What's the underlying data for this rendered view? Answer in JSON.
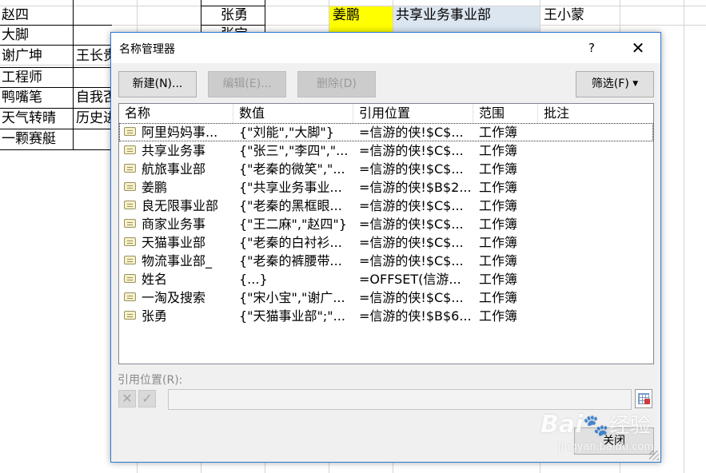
{
  "sheet": {
    "colA": [
      "赵四",
      "大脚",
      "谢广坤",
      "工程师",
      "鸭嘴笔",
      "天气转晴",
      "一颗赛艇"
    ],
    "colB": [
      "王长贵",
      "自我否",
      "历史进"
    ],
    "colD": [
      "张勇",
      "张宝"
    ],
    "header_row": {
      "highlight_cell": "姜鹏",
      "dept_cell": "共享业务事业部",
      "person_cell": "王小蒙"
    },
    "colors": {
      "yellow": "#ffff00",
      "light_blue": "#dce6f1"
    }
  },
  "dialog": {
    "title": "名称管理器",
    "help": "?",
    "buttons": {
      "new": "新建(N)...",
      "edit": "编辑(E)...",
      "delete": "删除(D)",
      "filter": "筛选(F)",
      "close": "关闭"
    },
    "columns": [
      "名称",
      "数值",
      "引用位置",
      "范围",
      "批注"
    ],
    "rows": [
      {
        "name": "阿里妈妈事...",
        "value": "{\"刘能\",\"大脚\"}",
        "ref": "=信游的侠!$C$...",
        "scope": "工作簿",
        "comment": ""
      },
      {
        "name": "共享业务事",
        "value": "{\"张三\",\"李四\",\"...",
        "ref": "=信游的侠!$C$...",
        "scope": "工作簿",
        "comment": ""
      },
      {
        "name": "航旅事业部",
        "value": "{\"老秦的微笑\",\"...",
        "ref": "=信游的侠!$C$...",
        "scope": "工作簿",
        "comment": ""
      },
      {
        "name": "姜鹏",
        "value": "{\"共享业务事业...",
        "ref": "=信游的侠!$B$2...",
        "scope": "工作簿",
        "comment": ""
      },
      {
        "name": "良无限事业部",
        "value": "{\"老秦的黑框眼...",
        "ref": "=信游的侠!$C$...",
        "scope": "工作簿",
        "comment": ""
      },
      {
        "name": "商家业务事",
        "value": "{\"王二麻\",\"赵四\"}",
        "ref": "=信游的侠!$C$...",
        "scope": "工作簿",
        "comment": ""
      },
      {
        "name": "天猫事业部",
        "value": "{\"老秦的白衬衫...",
        "ref": "=信游的侠!$C$...",
        "scope": "工作簿",
        "comment": ""
      },
      {
        "name": "物流事业部_",
        "value": "{\"老秦的裤腰带...",
        "ref": "=信游的侠!$C$...",
        "scope": "工作簿",
        "comment": ""
      },
      {
        "name": "姓名",
        "value": "{...}",
        "ref": "=OFFSET(信游...",
        "scope": "工作簿",
        "comment": ""
      },
      {
        "name": "一淘及搜索",
        "value": "{\"宋小宝\",\"谢广...",
        "ref": "=信游的侠!$C$...",
        "scope": "工作簿",
        "comment": ""
      },
      {
        "name": "张勇",
        "value": "{\"天猫事业部\";\"...",
        "ref": "=信游的侠!$B$6...",
        "scope": "工作簿",
        "comment": ""
      }
    ],
    "ref_label": "引用位置(R):",
    "ref_value": "",
    "colors": {
      "accent_border": "#2b79d1",
      "dialog_bg": "#f0f0f0"
    }
  },
  "watermark": {
    "brand": "Bai",
    "brand2": "经验",
    "url": "jingyan.baidu.com"
  }
}
